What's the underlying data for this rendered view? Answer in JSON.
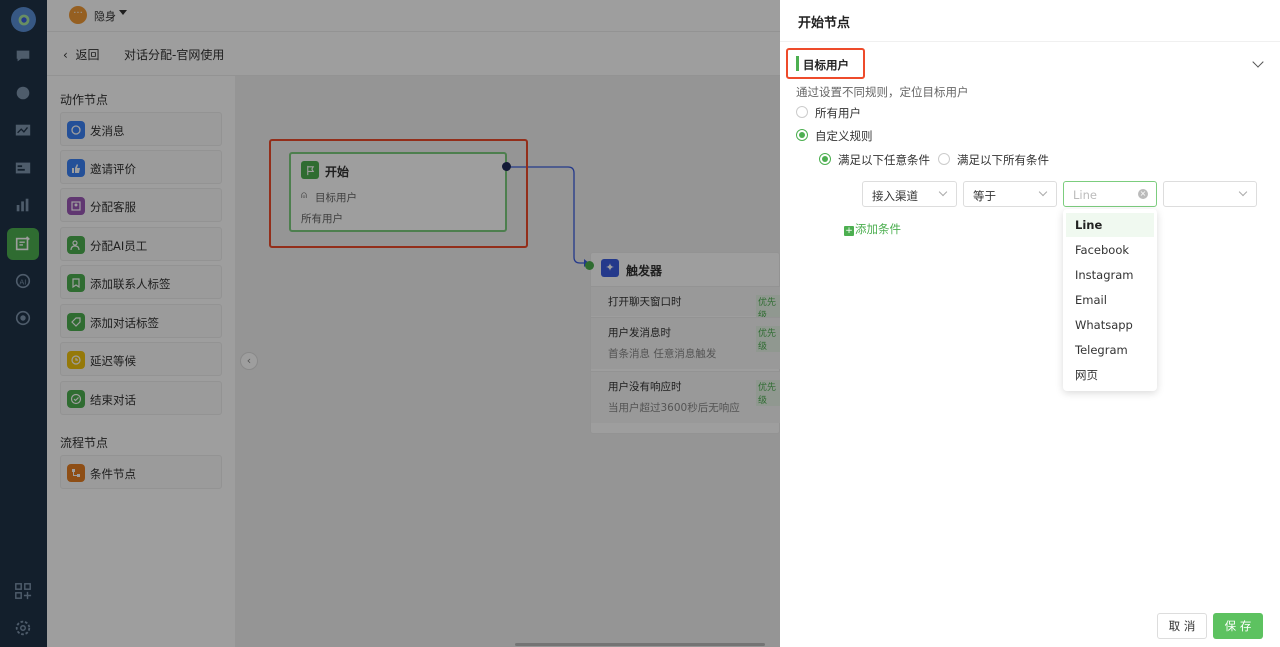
{
  "topbar": {
    "status_label": "隐身",
    "status_icon": "chat-bubble-icon"
  },
  "subbar": {
    "back_label": "返回",
    "flow_title": "对话分配-官网使用"
  },
  "palette": {
    "action_heading": "动作节点",
    "action_items": [
      {
        "label": "发消息",
        "icon": "message-icon",
        "color": "#3b82f6"
      },
      {
        "label": "邀请评价",
        "icon": "thumbs-up-icon",
        "color": "#3b82f6"
      },
      {
        "label": "分配客服",
        "icon": "agent-icon",
        "color": "#9b59b6"
      },
      {
        "label": "分配AI员工",
        "icon": "ai-agent-icon",
        "color": "#4caf50"
      },
      {
        "label": "添加联系人标签",
        "icon": "bookmark-icon",
        "color": "#4caf50"
      },
      {
        "label": "添加对话标签",
        "icon": "tag-icon",
        "color": "#4caf50"
      },
      {
        "label": "延迟等候",
        "icon": "clock-icon",
        "color": "#f1c40f"
      },
      {
        "label": "结束对话",
        "icon": "check-circle-icon",
        "color": "#4caf50"
      }
    ],
    "flow_heading": "流程节点",
    "flow_items": [
      {
        "label": "条件节点",
        "icon": "condition-icon",
        "color": "#e67e22"
      }
    ]
  },
  "canvas": {
    "start_node": {
      "title": "开始",
      "target_label": "目标用户",
      "target_value": "所有用户"
    },
    "trigger_node": {
      "title": "触发器",
      "rows": [
        {
          "title": "打开聊天窗口时",
          "badge": "优先级",
          "sub": ""
        },
        {
          "title": "用户发消息时",
          "badge": "优先级",
          "sub": "首条消息  任意消息触发"
        },
        {
          "title": "用户没有响应时",
          "badge": "优先级",
          "sub": "当用户超过3600秒后无响应"
        }
      ]
    }
  },
  "drawer": {
    "title": "开始节点",
    "section_title": "目标用户",
    "section_desc": "通过设置不同规则，定位目标用户",
    "option_all": "所有用户",
    "option_custom": "自定义规则",
    "match_any": "满足以下任意条件",
    "match_all": "满足以下所有条件",
    "condition": {
      "field": "接入渠道",
      "operator": "等于",
      "value_placeholder": "Line",
      "value2": ""
    },
    "add_condition": "添加条件",
    "dropdown_options": [
      "Line",
      "Facebook",
      "Instagram",
      "Email",
      "Whatsapp",
      "Telegram",
      "网页"
    ],
    "dropdown_selected": "Line",
    "cancel_label": "取 消",
    "save_label": "保 存"
  },
  "colors": {
    "accent": "#4caf50",
    "rail": "#1f3247",
    "highlight": "#ee4b2b"
  }
}
